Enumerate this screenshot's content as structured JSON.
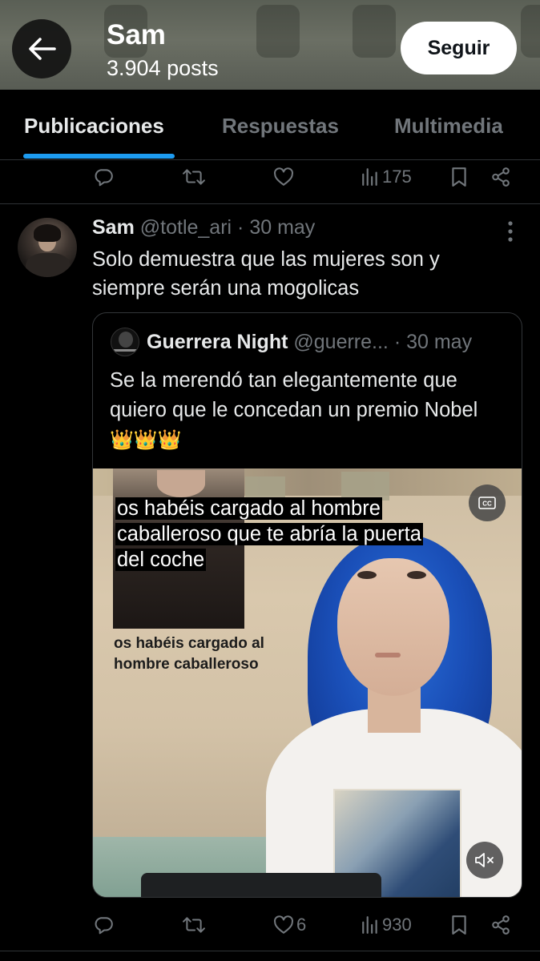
{
  "header": {
    "title": "Sam",
    "posts_count": "3.904 posts",
    "follow_label": "Seguir"
  },
  "tabs": [
    {
      "label": "Publicaciones",
      "active": true
    },
    {
      "label": "Respuestas",
      "active": false
    },
    {
      "label": "Multimedia",
      "active": false
    }
  ],
  "prev_tweet_actions": {
    "views": "175"
  },
  "tweet": {
    "name": "Sam",
    "handle": "@totle_ari",
    "separator": " · ",
    "date": "30 may",
    "text": "Solo demuestra que las mujeres son y siempre serán una mogolicas",
    "quote": {
      "name": "Guerrera Night",
      "handle": "@guerre...",
      "separator": " · ",
      "date": "30 may",
      "text": "Se la merendó tan elegantemente que quiero que le concedan un premio Nobel",
      "emoji": "👑👑👑",
      "video": {
        "subtitle_lines": [
          "os habéis cargado al hombre",
          "caballeroso que te abría la puerta",
          "del coche"
        ],
        "inset_caption_lines": [
          "os habéis cargado al",
          "hombre caballeroso"
        ]
      }
    },
    "actions": {
      "likes": "6",
      "views": "930"
    }
  },
  "colors": {
    "accent": "#1d9bf0",
    "muted": "#71767b",
    "text": "#e7e9ea",
    "background": "#000000"
  },
  "icons": [
    "back-arrow-icon",
    "reply-icon",
    "retweet-icon",
    "like-icon",
    "views-icon",
    "bookmark-icon",
    "share-icon",
    "more-icon",
    "cc-icon",
    "mute-icon"
  ]
}
